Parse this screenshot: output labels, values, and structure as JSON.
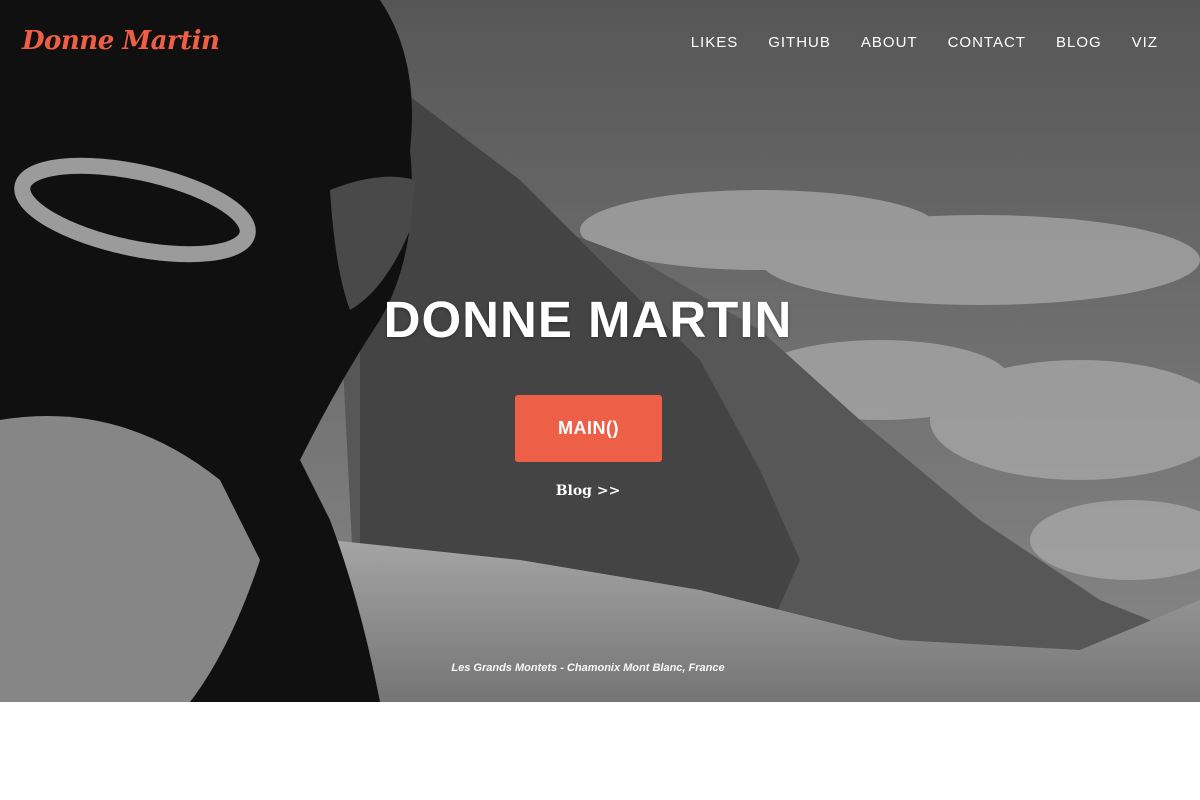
{
  "brand": {
    "name": "Donne Martin",
    "color": "#ef5f45"
  },
  "nav": {
    "items": [
      {
        "label": "LIKES"
      },
      {
        "label": "GITHUB"
      },
      {
        "label": "ABOUT"
      },
      {
        "label": "CONTACT"
      },
      {
        "label": "BLOG"
      },
      {
        "label": "VIZ"
      }
    ]
  },
  "hero": {
    "title": "DONNE MARTIN",
    "main_button_label": "MAIN()",
    "blog_link_label": "Blog >>",
    "caption": "Les Grands Montets - Chamonix Mont Blanc, France",
    "button_color": "#ee5f48",
    "background_image": "grayscale photo of skier in helmet and goggles overlooking snowy mountains and clouds"
  }
}
